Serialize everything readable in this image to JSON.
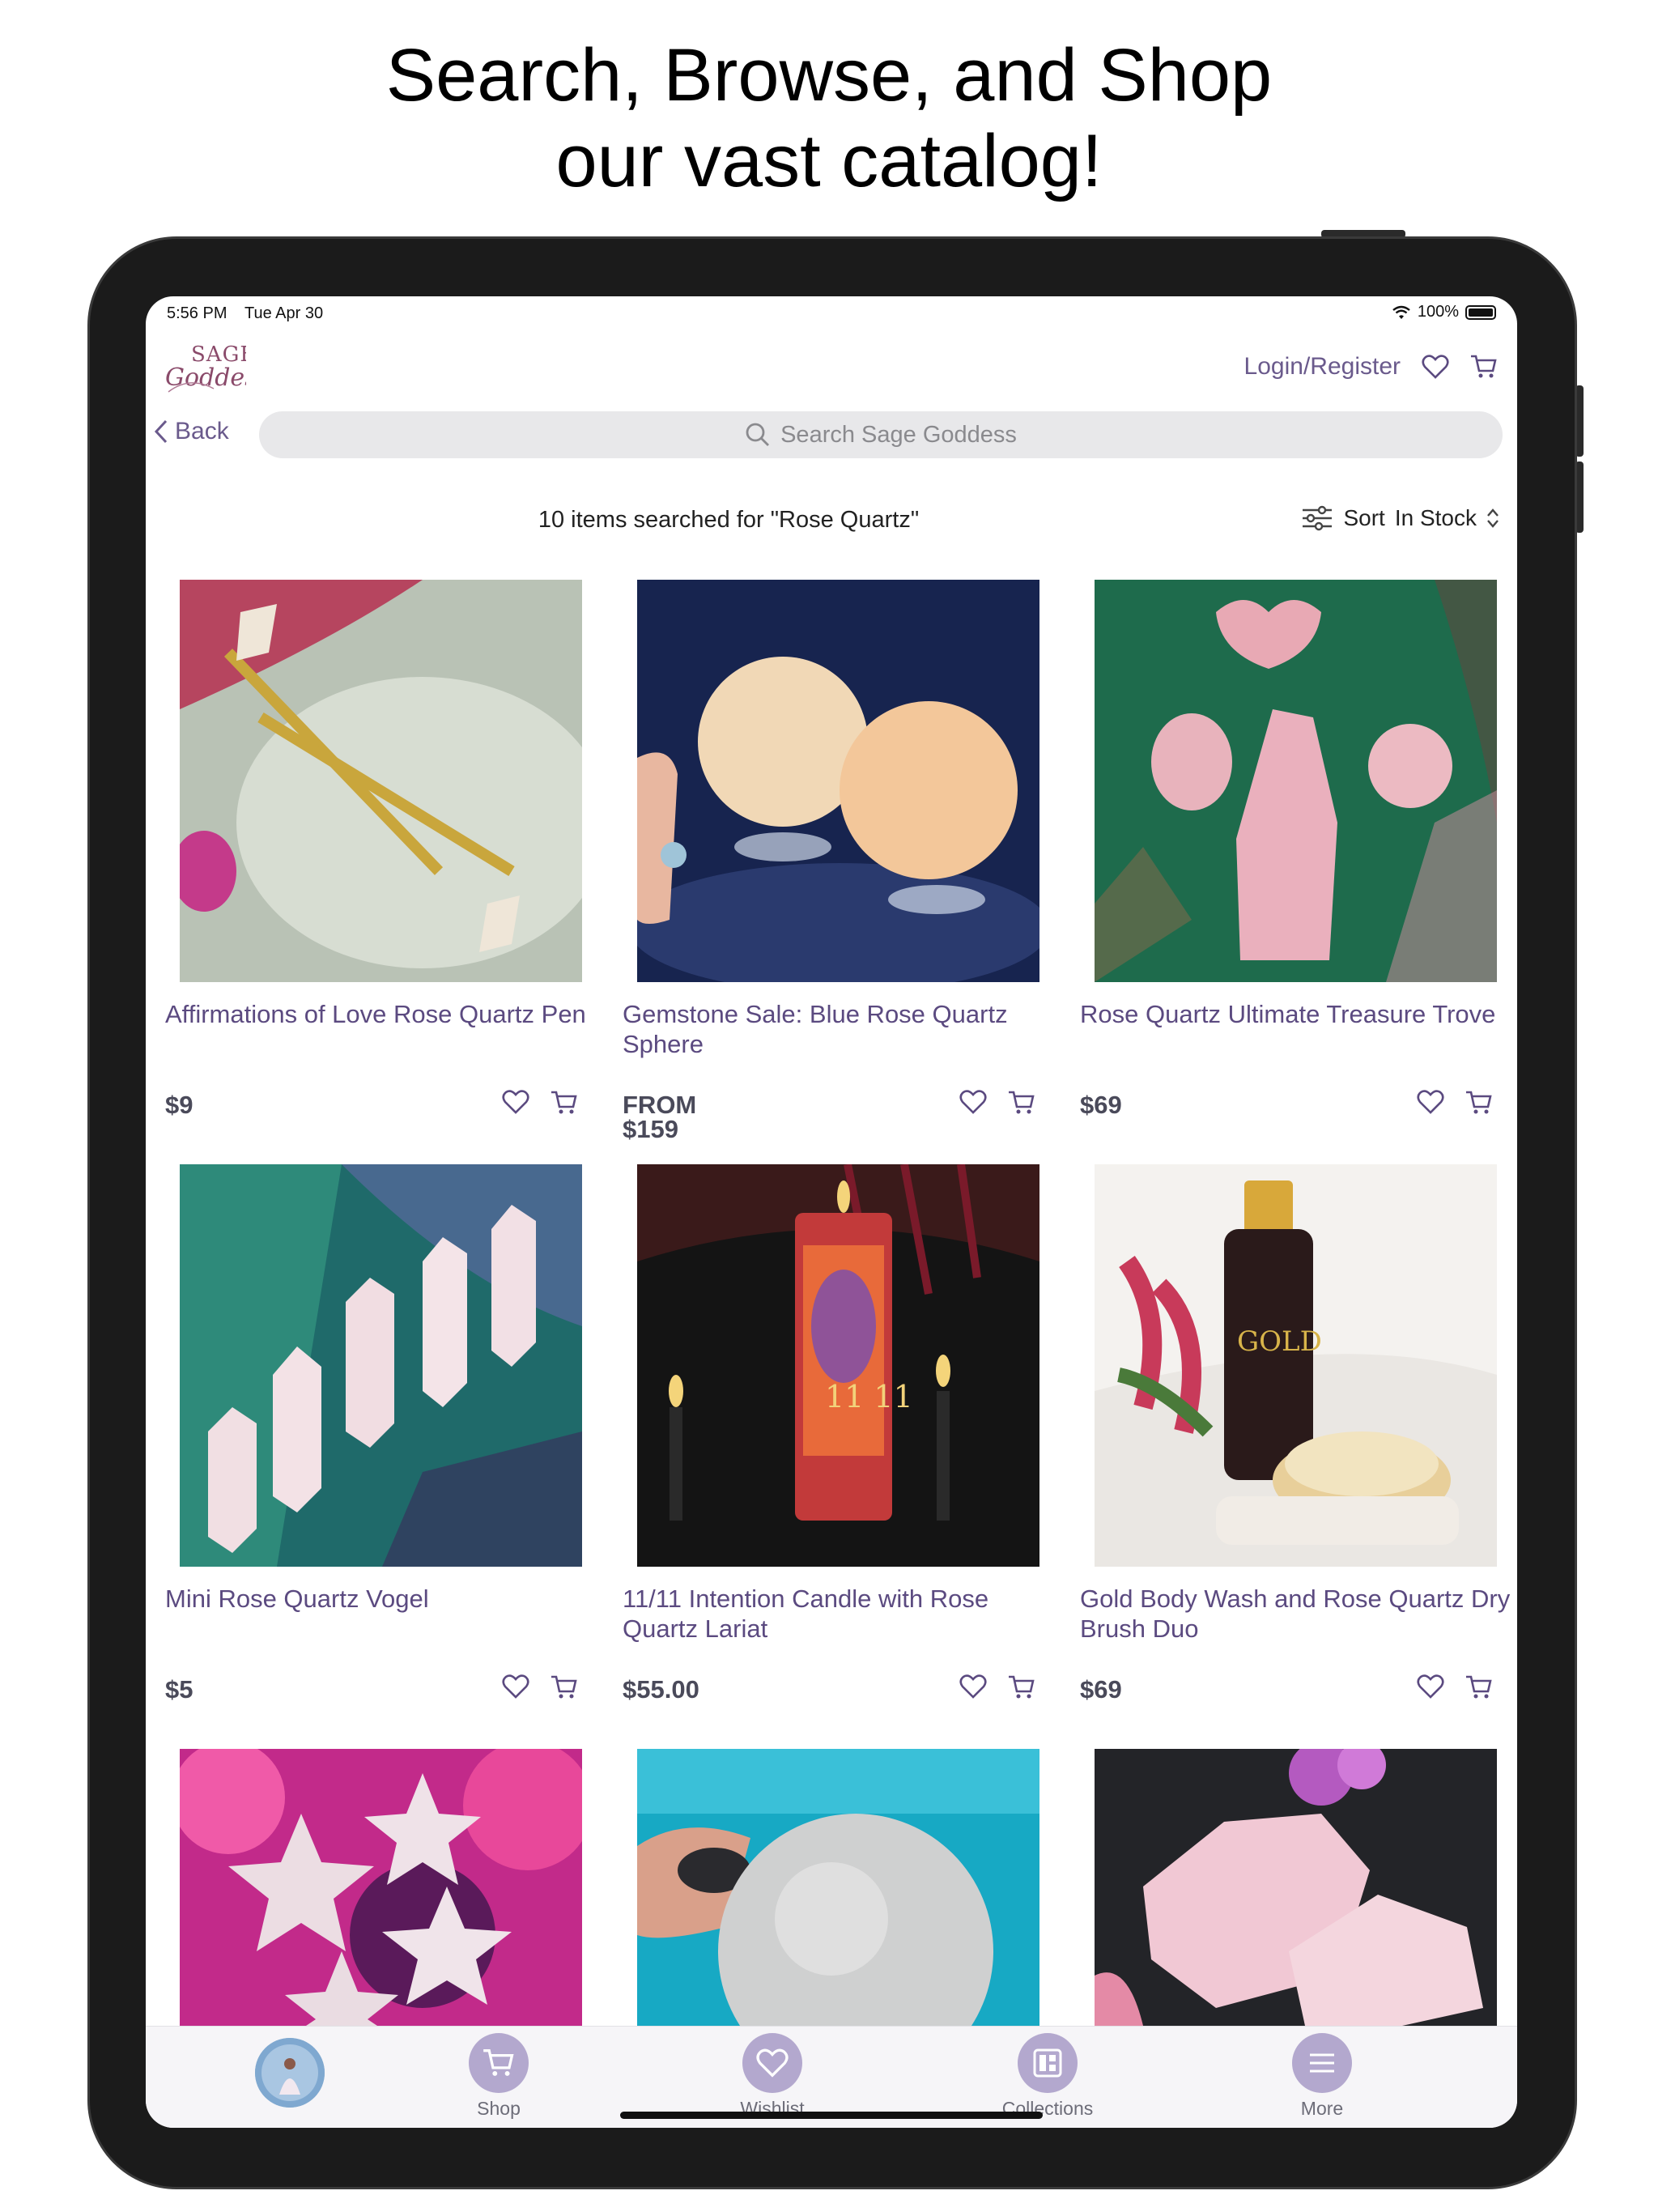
{
  "headline": {
    "line1": "Search, Browse, and Shop",
    "line2": "our vast catalog!"
  },
  "status_bar": {
    "time": "5:56 PM",
    "date": "Tue Apr 30",
    "battery": "100%"
  },
  "header": {
    "logo_text": "SAGE Goddess",
    "login_label": "Login/Register"
  },
  "nav": {
    "back_label": "Back"
  },
  "search": {
    "placeholder": "Search Sage Goddess"
  },
  "results": {
    "summary": "10 items searched for \"Rose Quartz\"",
    "sort_label": "Sort",
    "sort_value": "In Stock"
  },
  "products": [
    {
      "title": "Affirmations of Love Rose Quartz Pen",
      "price": "$9",
      "price_prefix": ""
    },
    {
      "title": "Gemstone Sale: Blue Rose Quartz Sphere",
      "price": "$159",
      "price_prefix": "FROM"
    },
    {
      "title": "Rose Quartz Ultimate Treasure Trove",
      "price": "$69",
      "price_prefix": ""
    },
    {
      "title": "Mini Rose Quartz Vogel",
      "price": "$5",
      "price_prefix": ""
    },
    {
      "title": "11/11 Intention Candle with Rose Quartz Lariat",
      "price": "$55.00",
      "price_prefix": ""
    },
    {
      "title": "Gold Body Wash and Rose Quartz Dry Brush Duo",
      "price": "$69",
      "price_prefix": ""
    }
  ],
  "tabbar": {
    "shop": "Shop",
    "wishlist": "Wishlist",
    "collections": "Collections",
    "more": "More"
  },
  "icons": {
    "heart": "heart-icon",
    "cart": "cart-icon",
    "search": "search-icon",
    "back": "chevron-left-icon",
    "sort": "sliders-icon"
  },
  "colors": {
    "accent": "#6a5a8c",
    "tab_circle": "#b3a8ce",
    "price": "#4a4a5a"
  }
}
